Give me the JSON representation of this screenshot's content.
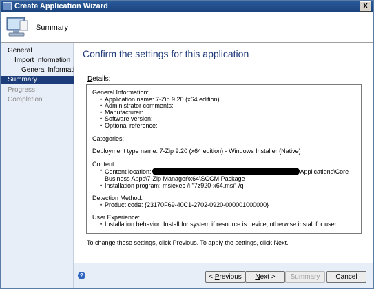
{
  "window": {
    "title": "Create Application Wizard",
    "close_label": "X"
  },
  "header": {
    "title": "Summary",
    "icon": "computer-monitor-icon"
  },
  "nav": {
    "items": [
      {
        "label": "General",
        "state": "normal"
      },
      {
        "label": "Import Information",
        "state": "normal"
      },
      {
        "label": "General Information",
        "state": "normal"
      },
      {
        "label": "Summary",
        "state": "selected"
      },
      {
        "label": "Progress",
        "state": "disabled"
      },
      {
        "label": "Completion",
        "state": "disabled"
      }
    ]
  },
  "main": {
    "title": "Confirm the settings for this application",
    "details_label_acc": "D",
    "details_label_rest": "etails:",
    "details": {
      "general_heading": "General Information:",
      "general_items": [
        "Application name: 7-Zip 9.20 (x64 edition)",
        "Administrator comments:",
        "Manufacturer:",
        "Software version:",
        "Optional reference:"
      ],
      "categories": "Categories:",
      "deployment_type": "Deployment type name: 7-Zip 9.20 (x64 edition) - Windows Installer (Native)",
      "content_heading": "Content:",
      "content_location_prefix": "Content location:",
      "content_location_suffix": "Applications\\Core",
      "content_location_cont": "Business Apps\\7-Zip Manager\\x64\\SCCM Package",
      "install_program": "Installation program: msiexec /i \"7z920-x64.msi\" /q",
      "detection_heading": "Detection Method:",
      "product_code": "Product code: {23170F69-40C1-2702-0920-000001000000}",
      "ux_heading": "User Experience:",
      "install_behavior": "Installation behavior: Install for system if resource is device; otherwise install for user"
    },
    "hint": "To change these settings, click Previous. To apply the settings, click Next."
  },
  "footer": {
    "help_glyph": "?",
    "previous": {
      "acc": "P",
      "rest": "revious",
      "prefix": "< "
    },
    "next": {
      "acc": "N",
      "rest": "ext >"
    },
    "summary": "Summary",
    "cancel": "Cancel"
  },
  "colors": {
    "title_bar": "#1f4a86",
    "nav_selected": "#1d3d7a",
    "title_text": "#1f3a7a"
  }
}
